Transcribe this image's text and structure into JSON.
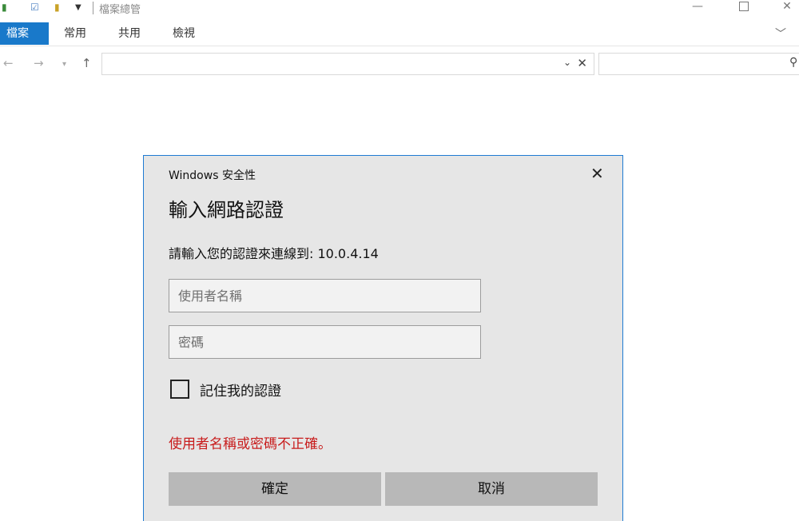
{
  "window": {
    "title": "檔案總管",
    "quick_access": [
      "save-icon",
      "properties-check-icon",
      "new-folder-icon",
      "customize-dropdown-icon"
    ],
    "minimize_glyph": "—",
    "close_glyph": "✕"
  },
  "ribbon": {
    "tabs": [
      {
        "label": "檔案",
        "active": true
      },
      {
        "label": "常用"
      },
      {
        "label": "共用"
      },
      {
        "label": "檢視"
      }
    ],
    "expand_glyph": "﹀"
  },
  "navigation": {
    "back_glyph": "←",
    "forward_glyph": "→",
    "recent_glyph": "▾",
    "up_glyph": "↑",
    "address_value": "",
    "address_dropdown_glyph": "⌄",
    "address_clear_glyph": "✕",
    "search_value": "",
    "search_glyph": "⚲"
  },
  "dialog": {
    "caption": "Windows 安全性",
    "close_glyph": "✕",
    "heading": "輸入網路認證",
    "prompt": "請輸入您的認證來連線到: 10.0.4.14",
    "username_placeholder": "使用者名稱",
    "password_placeholder": "密碼",
    "remember_label": "記住我的認證",
    "remember_checked": false,
    "error_message": "使用者名稱或密碼不正確。",
    "ok_label": "確定",
    "cancel_label": "取消",
    "colors": {
      "accent_border": "#1f7bd3",
      "error": "#c81d1d",
      "background": "#e6e6e6",
      "button": "#b8b8b8"
    }
  }
}
